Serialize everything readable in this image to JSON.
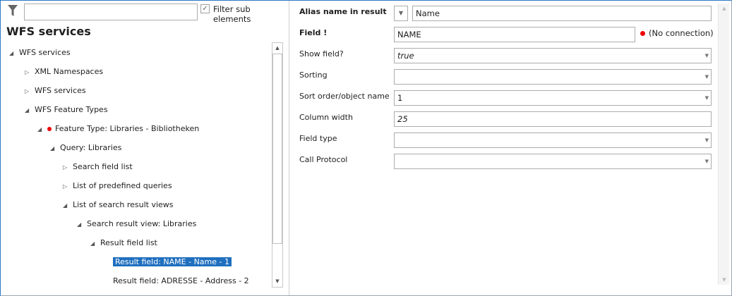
{
  "left": {
    "search": {
      "value": "",
      "placeholder": ""
    },
    "filter_sub_elements": {
      "label": "Filter sub elements",
      "checked": true
    },
    "title": "WFS services",
    "tree": [
      {
        "label": "WFS services",
        "state": "expanded",
        "level": 0
      },
      {
        "label": "XML Namespaces",
        "state": "collapsed",
        "level": 1
      },
      {
        "label": "WFS services",
        "state": "collapsed",
        "level": 1
      },
      {
        "label": "WFS Feature Types",
        "state": "expanded",
        "level": 1
      },
      {
        "label": "Feature Type: Libraries - Bibliotheken",
        "state": "expanded",
        "level": 2,
        "error": true
      },
      {
        "label": "Query: Libraries",
        "state": "expanded",
        "level": 3
      },
      {
        "label": "Search field list",
        "state": "collapsed",
        "level": 4
      },
      {
        "label": "List of predefined queries",
        "state": "collapsed",
        "level": 4
      },
      {
        "label": "List of search result views",
        "state": "expanded",
        "level": 4
      },
      {
        "label": "Search result view: Libraries",
        "state": "expanded",
        "level": 5
      },
      {
        "label": "Result field list",
        "state": "expanded",
        "level": 6
      },
      {
        "label": "Result field: NAME - Name - 1",
        "state": "leaf",
        "level": 7,
        "selected": true
      },
      {
        "label": "Result field: ADRESSE - Address - 2",
        "state": "leaf",
        "level": 7
      }
    ]
  },
  "right": {
    "alias": {
      "label": "Alias name in result",
      "value": "Name"
    },
    "field": {
      "label": "Field !",
      "value": "NAME",
      "status": "(No connection)"
    },
    "show_field": {
      "label": "Show field?",
      "value": "true"
    },
    "sorting": {
      "label": "Sorting",
      "value": ""
    },
    "sort_order": {
      "label": "Sort order/object name",
      "value": "1"
    },
    "column_width": {
      "label": "Column width",
      "value": "25"
    },
    "field_type": {
      "label": "Field type",
      "value": ""
    },
    "call_protocol": {
      "label": "Call Protocol",
      "value": ""
    }
  },
  "colors": {
    "selection": "#1f6fbf",
    "error": "#e00000",
    "border": "#2b78c5"
  }
}
